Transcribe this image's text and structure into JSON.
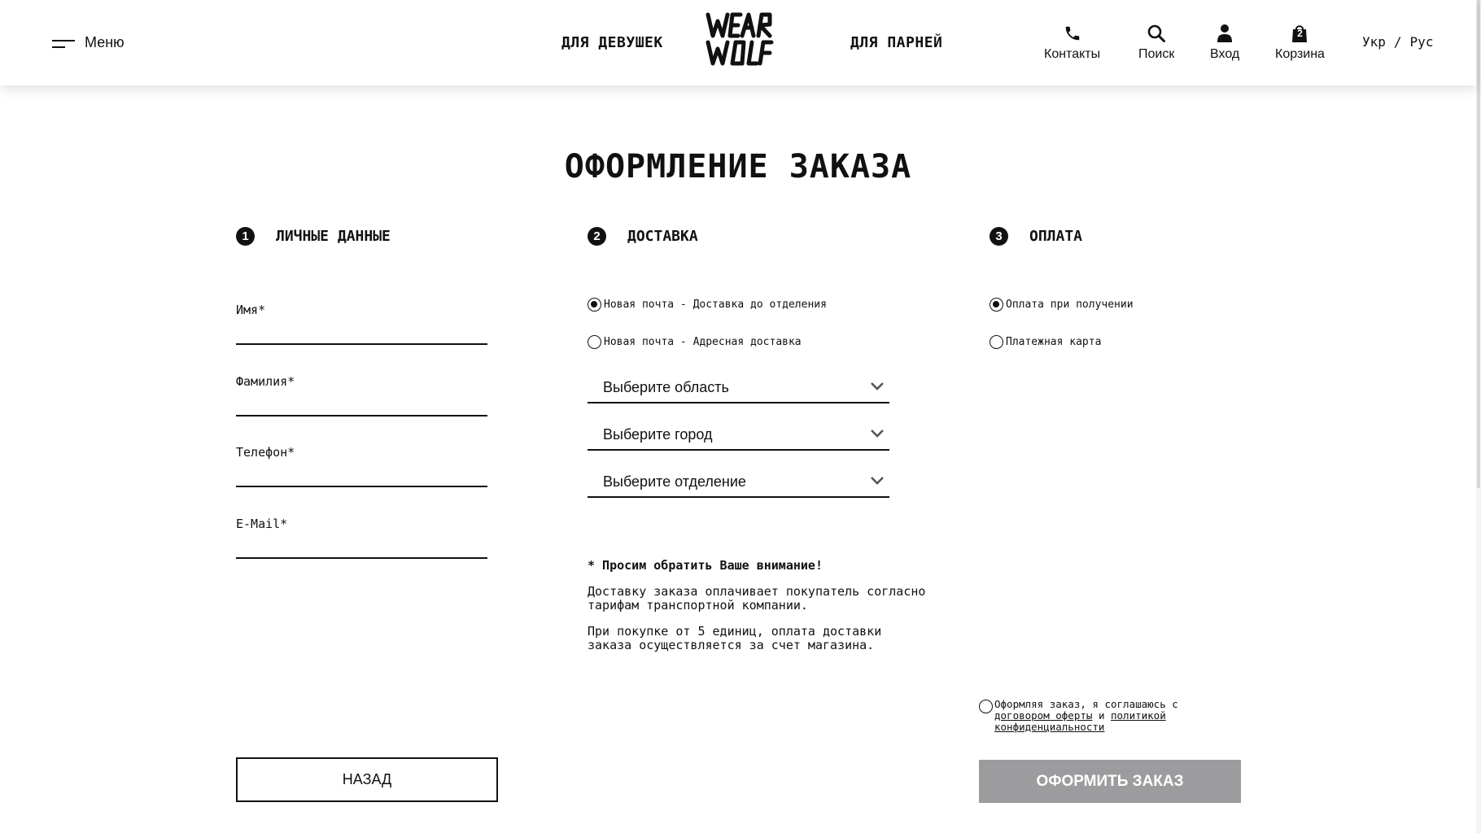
{
  "header": {
    "menu_label": "Меню",
    "nav_girls": "ДЛЯ ДЕВУШЕК",
    "nav_boys": "ДЛЯ ПАРНЕЙ",
    "logo_text": "WEAR WOLF",
    "contacts_label": "Контакты",
    "search_label": "Поиск",
    "login_label": "Вход",
    "cart_label": "Корзина",
    "cart_count": "2",
    "lang_ukr": "Укр",
    "lang_sep": "/",
    "lang_rus": "Рус"
  },
  "page": {
    "title": "ОФОРМЛЕНИЕ ЗАКАЗА"
  },
  "steps": [
    {
      "num": "1",
      "title": "ЛИЧНЫЕ ДАННЫЕ"
    },
    {
      "num": "2",
      "title": "ДОСТАВКА"
    },
    {
      "num": "3",
      "title": "ОПЛАТА"
    }
  ],
  "personal": {
    "first_name_label": "Имя*",
    "first_name_value": "",
    "last_name_label": "Фамилия*",
    "last_name_value": "",
    "phone_label": "Телефон*",
    "phone_value": "",
    "email_label": "E-Mail*",
    "email_value": ""
  },
  "delivery": {
    "options": [
      {
        "label": "Новая почта - Доставка до отделения",
        "selected": true
      },
      {
        "label": "Новая почта - Адресная доставка",
        "selected": false
      }
    ],
    "region_placeholder": "Выберите область",
    "city_placeholder": "Выберите город",
    "branch_placeholder": "Выберите отделение",
    "notice_title": "* Просим обратить Ваше внимание!",
    "notice_p1": "Доставку заказа оплачивает покупатель согласно тарифам транспортной компании.",
    "notice_p2": "При покупке от 5 единиц, оплата доставки заказа осуществляется за счет магазина."
  },
  "payment": {
    "options": [
      {
        "label": "Оплата при получении",
        "selected": true
      },
      {
        "label": "Платежная карта",
        "selected": false
      }
    ]
  },
  "agreement": {
    "text_before": "Оформляя заказ, я соглашаюсь с ",
    "offer_link": "договором оферты",
    "text_and": " и ",
    "privacy_link": "политикой конфиденциальности",
    "checked": false
  },
  "buttons": {
    "back": "НАЗАД",
    "submit": "ОФОРМИТЬ ЗАКАЗ"
  },
  "colors": {
    "text": "#111111",
    "submit_bg": "#9c9c9f",
    "background": "#ffffff"
  }
}
